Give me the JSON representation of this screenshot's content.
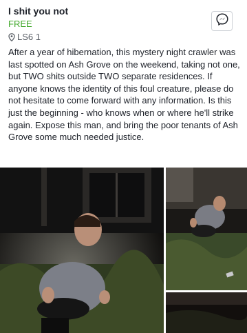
{
  "listing": {
    "title": "I shit you not",
    "price": "FREE",
    "location": "LS6 1",
    "description": "After a year of hibernation, this mystery night crawler was last spotted on Ash Grove on the weekend, taking not one, but TWO shits outside TWO separate residences. If anyone knows the identity of this foul creature, please do not hesitate to come forward with any information. Is this just the beginning - who knows when or where he'll strike again. Expose this man, and bring the poor tenants of Ash Grove some much needed justice."
  },
  "icons": {
    "location": "location-pin-icon",
    "messenger": "messenger-icon"
  },
  "colors": {
    "price": "#42a82b",
    "location": "#5a5f66",
    "text": "#1d2129"
  }
}
